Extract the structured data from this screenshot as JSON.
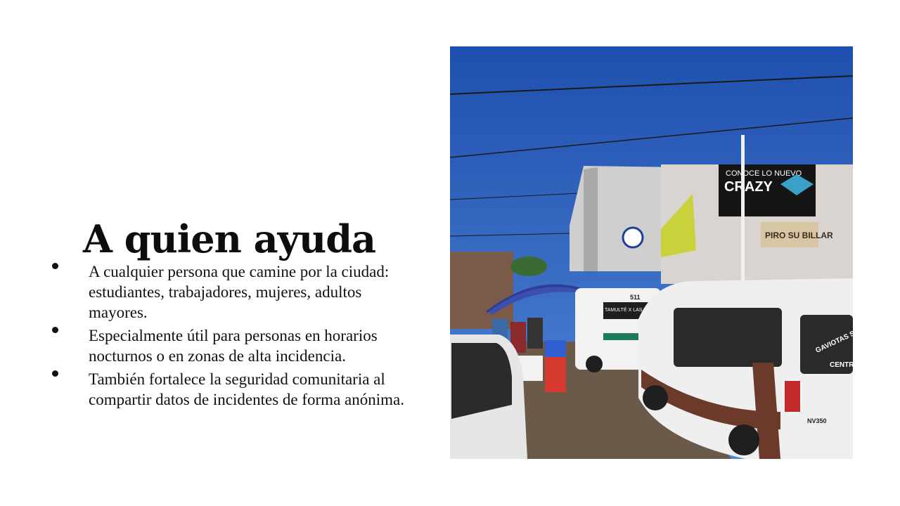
{
  "slide": {
    "title": "A quien ayuda",
    "bullets": [
      {
        "text": "A cualquier persona que camine por la ciudad: estudiantes, trabajadores, mujeres, adultos mayores."
      },
      {
        "text": "Especialmente útil para personas en horarios nocturnos o en zonas de alta incidencia."
      },
      {
        "text": "También fortalece la seguridad comunitaria al compartir datos de incidentes de forma anónima."
      }
    ]
  },
  "photo": {
    "sign_lines": [
      "CONOCE LO NUEVO",
      "CRAZY"
    ],
    "billar_sign": "PIRO SU BILLAR",
    "bus_route": "TAMULTÉ X LAS FUENTE MERCADO",
    "bus_number": "511",
    "van_brand": "NV350",
    "van_side_text": "GAVIOTAS SUR",
    "van_center_text": "CENTRO"
  },
  "colors": {
    "sky": "#2f5fb8",
    "van_white": "#eeeeee",
    "van_brown": "#6b3a2a",
    "umbrella": "#3a4fb0"
  }
}
